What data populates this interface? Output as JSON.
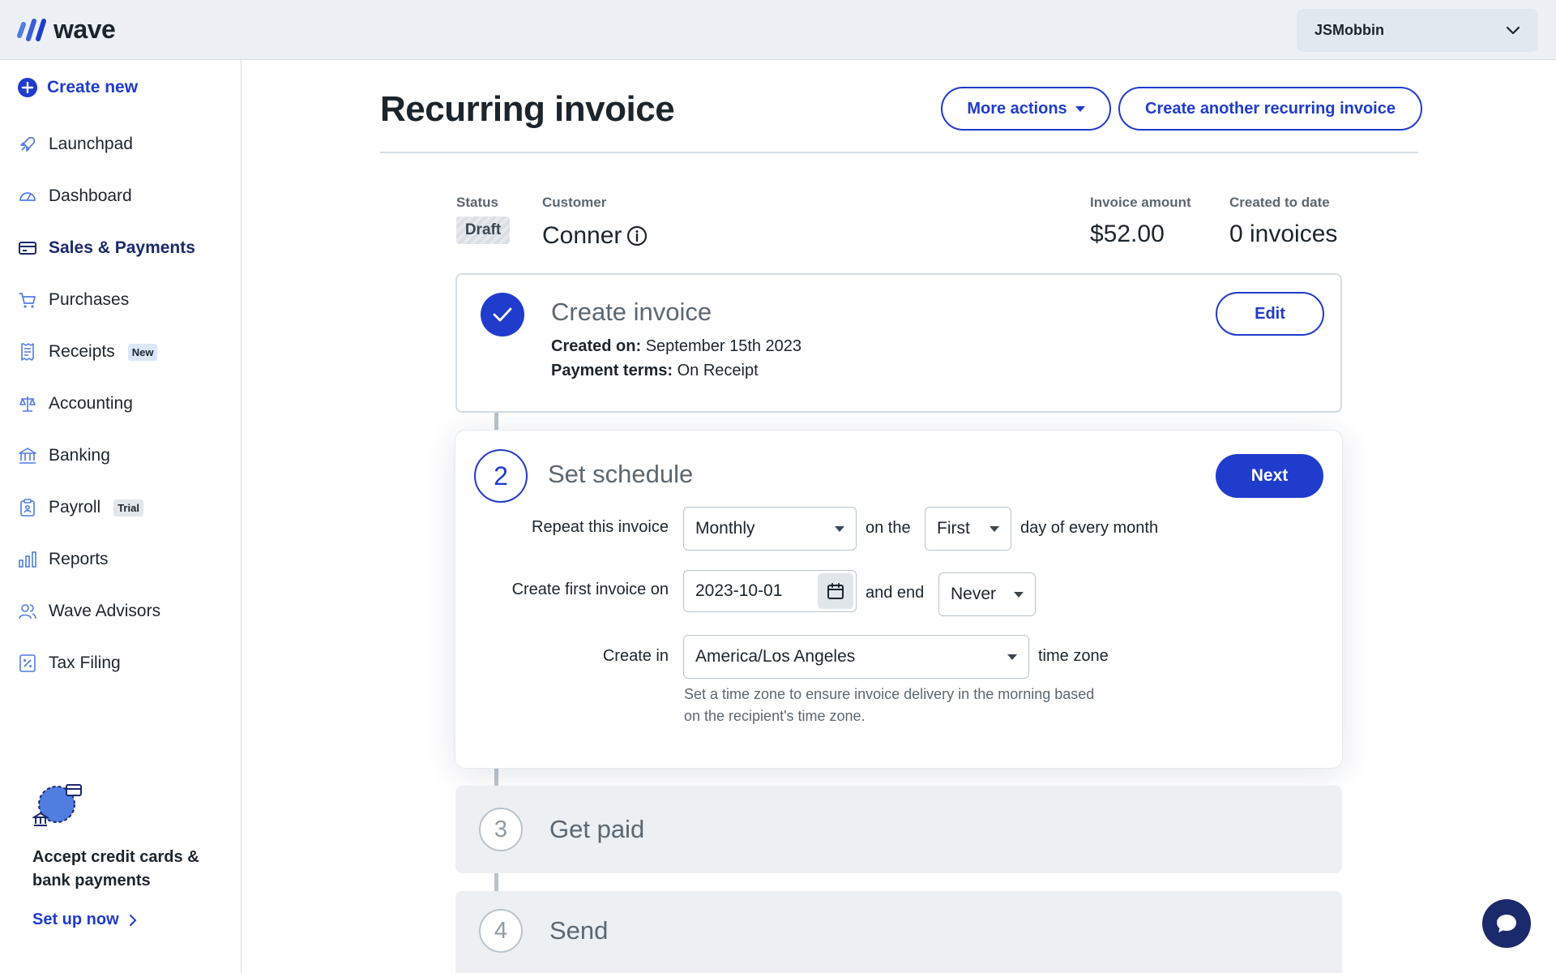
{
  "app": {
    "logo_text": "wave"
  },
  "user_menu": {
    "name": "JSMobbin"
  },
  "sidebar": {
    "create_new": "Create new",
    "items": [
      {
        "label": "Launchpad",
        "icon": "rocket-icon"
      },
      {
        "label": "Dashboard",
        "icon": "gauge-icon"
      },
      {
        "label": "Sales & Payments",
        "icon": "card-icon",
        "active": true
      },
      {
        "label": "Purchases",
        "icon": "cart-icon"
      },
      {
        "label": "Receipts",
        "icon": "receipt-icon",
        "badge": "New"
      },
      {
        "label": "Accounting",
        "icon": "scale-icon"
      },
      {
        "label": "Banking",
        "icon": "bank-icon"
      },
      {
        "label": "Payroll",
        "icon": "clipboard-icon",
        "badge": "Trial"
      },
      {
        "label": "Reports",
        "icon": "bar-chart-icon"
      },
      {
        "label": "Wave Advisors",
        "icon": "people-icon"
      },
      {
        "label": "Tax Filing",
        "icon": "percent-doc-icon"
      }
    ],
    "promo": {
      "title": "Accept credit cards & bank payments",
      "link": "Set up now"
    }
  },
  "header": {
    "title": "Recurring invoice",
    "more_actions": "More actions",
    "create_another": "Create another recurring invoice"
  },
  "summary": {
    "status_label": "Status",
    "status_value": "Draft",
    "customer_label": "Customer",
    "customer_value": "Conner",
    "amount_label": "Invoice amount",
    "amount_value": "$52.00",
    "created_label": "Created to date",
    "created_value": "0 invoices"
  },
  "steps": {
    "create_invoice": {
      "title": "Create invoice",
      "edit": "Edit",
      "created_on_label": "Created on:",
      "created_on_value": "September 15th 2023",
      "payment_terms_label": "Payment terms:",
      "payment_terms_value": "On Receipt"
    },
    "set_schedule": {
      "number": "2",
      "title": "Set schedule",
      "next": "Next",
      "repeat_label": "Repeat this invoice",
      "repeat_value": "Monthly",
      "on_the": "on the",
      "day_value": "First",
      "day_suffix": "day of every month",
      "first_invoice_label": "Create first invoice on",
      "first_invoice_date": "2023-10-01",
      "and_end": "and end",
      "end_value": "Never",
      "create_in_label": "Create in",
      "timezone_value": "America/Los Angeles",
      "timezone_suffix": "time zone",
      "helper": "Set a time zone to ensure invoice delivery in the morning based on the recipient's time zone."
    },
    "get_paid": {
      "number": "3",
      "title": "Get paid"
    },
    "send": {
      "number": "4",
      "title": "Send"
    }
  },
  "colors": {
    "accent": "#1f3ccc",
    "navy": "#1a2a6c",
    "topbar": "#edf1f5"
  }
}
